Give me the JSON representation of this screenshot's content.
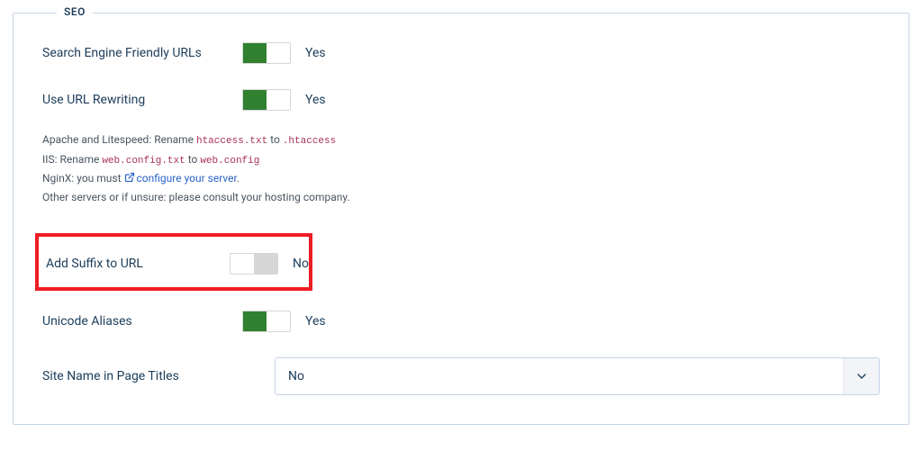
{
  "section_title": "SEO",
  "rows": {
    "sef": {
      "label": "Search Engine Friendly URLs",
      "value": "Yes"
    },
    "rewrite": {
      "label": "Use URL Rewriting",
      "value": "Yes"
    },
    "suffix": {
      "label": "Add Suffix to URL",
      "value": "No"
    },
    "unicode": {
      "label": "Unicode Aliases",
      "value": "Yes"
    },
    "sitename": {
      "label": "Site Name in Page Titles",
      "value": "No"
    }
  },
  "help": {
    "line1_pre": "Apache and Litespeed: Rename ",
    "line1_code1": "htaccess.txt",
    "line1_mid": " to ",
    "line1_code2": ".htaccess",
    "line2_pre": "IIS: Rename ",
    "line2_code1": "web.config.txt",
    "line2_mid": " to ",
    "line2_code2": "web.config",
    "line3_pre": "NginX: you must ",
    "line3_link": "configure your server",
    "line3_post": ".",
    "line4": "Other servers or if unsure: please consult your hosting company."
  }
}
